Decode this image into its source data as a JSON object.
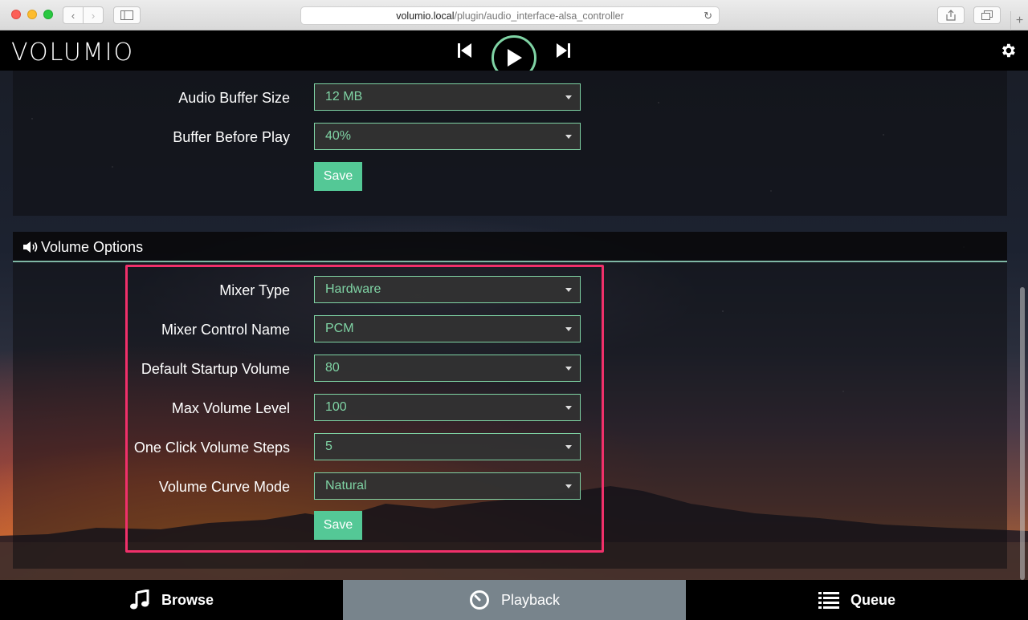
{
  "browser": {
    "url_host": "volumio.local",
    "url_path": "/plugin/audio_interface-alsa_controller"
  },
  "header": {
    "logo": "VOLUMIO",
    "icons": [
      "previous-icon",
      "play-icon",
      "next-icon",
      "gear-icon"
    ]
  },
  "playback_section": {
    "rows": [
      {
        "label": "Audio Buffer Size",
        "value": "12 MB"
      },
      {
        "label": "Buffer Before Play",
        "value": "40%"
      }
    ],
    "save_label": "Save"
  },
  "volume_section": {
    "title": "Volume Options",
    "rows": [
      {
        "label": "Mixer Type",
        "value": "Hardware"
      },
      {
        "label": "Mixer Control Name",
        "value": "PCM"
      },
      {
        "label": "Default Startup Volume",
        "value": "80"
      },
      {
        "label": "Max Volume Level",
        "value": "100"
      },
      {
        "label": "One Click Volume Steps",
        "value": "5"
      },
      {
        "label": "Volume Curve Mode",
        "value": "Natural"
      }
    ],
    "save_label": "Save"
  },
  "footer": {
    "tabs": [
      {
        "label": "Browse",
        "icon": "music-note-icon",
        "active": false
      },
      {
        "label": "Playback",
        "icon": "clock-icon",
        "active": true
      },
      {
        "label": "Queue",
        "icon": "list-icon",
        "active": false
      }
    ]
  },
  "colors": {
    "accent": "#7fd3a4",
    "save_button": "#54c896",
    "highlight_box": "#f0306a",
    "active_tab": "#78848c"
  }
}
